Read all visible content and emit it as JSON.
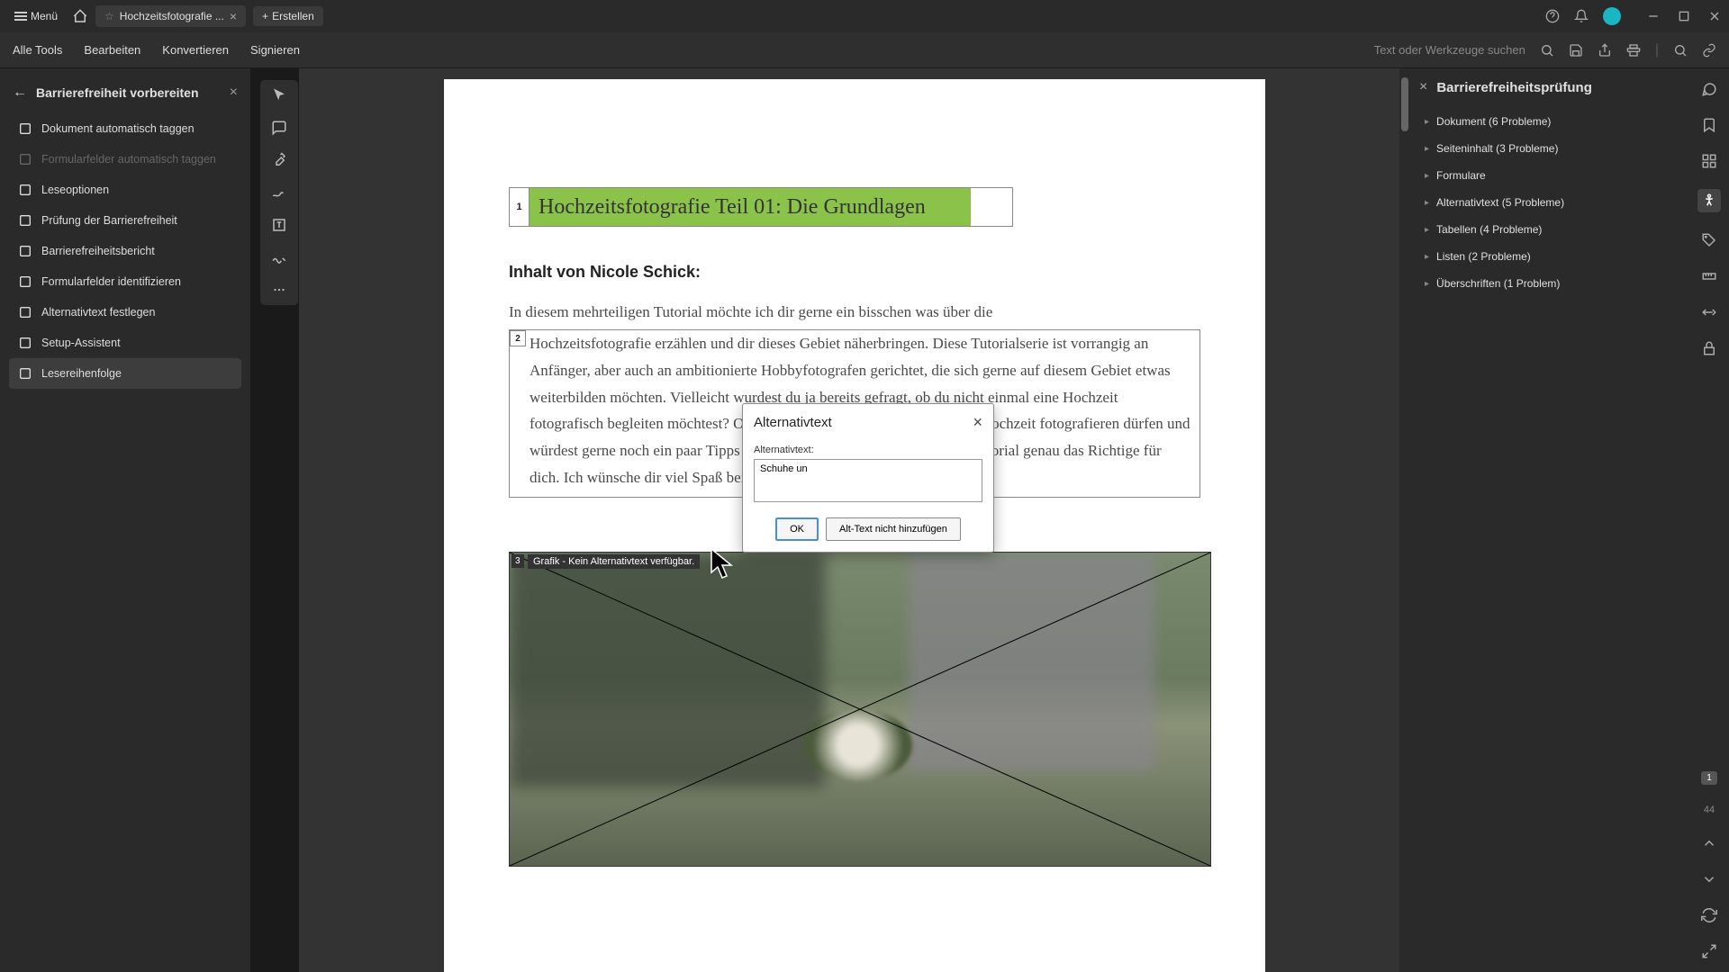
{
  "titlebar": {
    "menu": "Menü",
    "tab_title": "Hochzeitsfotografie ...",
    "create": "Erstellen"
  },
  "toolbar": {
    "all_tools": "Alle Tools",
    "edit": "Bearbeiten",
    "convert": "Konvertieren",
    "sign": "Signieren",
    "search_placeholder": "Text oder Werkzeuge suchen"
  },
  "left_panel": {
    "title": "Barrierefreiheit vorbereiten",
    "items": [
      {
        "label": "Dokument automatisch taggen",
        "disabled": false
      },
      {
        "label": "Formularfelder automatisch taggen",
        "disabled": true
      },
      {
        "label": "Leseoptionen",
        "disabled": false
      },
      {
        "label": "Prüfung der Barrierefreiheit",
        "disabled": false
      },
      {
        "label": "Barrierefreiheitsbericht",
        "disabled": false
      },
      {
        "label": "Formularfelder identifizieren",
        "disabled": false
      },
      {
        "label": "Alternativtext festlegen",
        "disabled": false
      },
      {
        "label": "Setup-Assistent",
        "disabled": false
      },
      {
        "label": "Lesereihenfolge",
        "disabled": false,
        "selected": true
      }
    ]
  },
  "document": {
    "tag1": "1",
    "heading": "Hochzeitsfotografie Teil 01: Die Grundlagen",
    "subheading": "Inhalt von Nicole Schick:",
    "intro": "In diesem mehrteiligen Tutorial möchte ich dir gerne ein bisschen was über die",
    "tag2": "2",
    "paragraph": "Hochzeitsfotografie erzählen und dir dieses Gebiet näherbringen. Diese Tutorialserie ist vorrangig an Anfänger, aber auch an ambitionierte Hobbyfotografen gerichtet, die sich gerne auf diesem Gebiet etwas weiterbilden möchten. Vielleicht wurdest du ja bereits gefragt, ob du nicht einmal eine Hochzeit fotografisch begleiten möchtest? Oder du hast bereits die ein oder andere Hochzeit fotografieren dürfen und würdest gerne noch ein paar Tipps und Tricks erfahren? Dann ist dieses Tutorial genau das Richtige für dich. Ich wünsche dir viel Spaß beim Lesen ...",
    "tag3": "3",
    "img_label": "Grafik - Kein Alternativtext verfügbar."
  },
  "dialog": {
    "title": "Alternativtext",
    "label": "Alternativtext:",
    "value": "Schuhe un",
    "ok": "OK",
    "skip": "Alt-Text nicht hinzufügen"
  },
  "right_panel": {
    "title": "Barrierefreiheitsprüfung",
    "items": [
      "Dokument (6 Probleme)",
      "Seiteninhalt (3 Probleme)",
      "Formulare",
      "Alternativtext (5 Probleme)",
      "Tabellen (4 Probleme)",
      "Listen (2 Probleme)",
      "Überschriften (1 Problem)"
    ]
  },
  "page_nav": {
    "current": "1",
    "total": "44"
  }
}
